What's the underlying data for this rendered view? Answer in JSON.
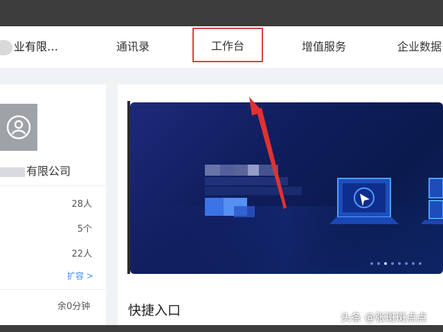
{
  "nav": {
    "company": "业有限…",
    "items": [
      "通讯录",
      "工作台",
      "增值服务",
      "企业数据"
    ],
    "active": "工作台"
  },
  "sidebar": {
    "org_name": "有限公司",
    "stats": [
      "28人",
      "5个",
      "22人"
    ],
    "expand": "扩容 >",
    "remaining": "余0分钟"
  },
  "main": {
    "section_title": "快捷入口"
  },
  "watermark": "头条 @张斑斑点点",
  "colors": {
    "highlight": "#e03b3b",
    "link": "#3c8ce8",
    "banner": "#0f1d5c"
  }
}
